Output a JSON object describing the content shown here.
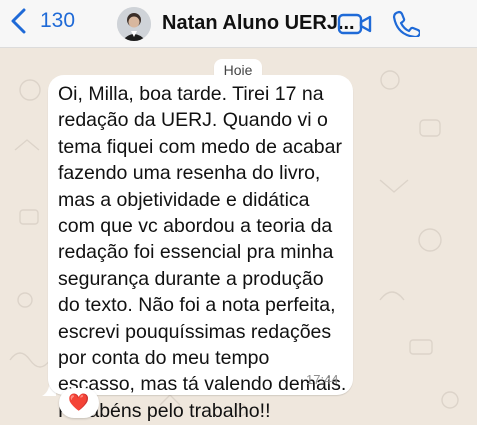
{
  "header": {
    "back_count": "130",
    "contact_name": "Natan Aluno UERJ..."
  },
  "chat": {
    "date_divider": "Hoje",
    "message": {
      "text": "Oi, Milla, boa tarde. Tirei 17 na redação da UERJ. Quando vi o tema fiquei com medo de acabar fazendo uma resenha do livro, mas a objetividade e didática com que vc abordou a teoria da redação foi essencial pra minha segurança durante a produção do texto. Não foi a nota perfeita, escrevi pouquíssimas redações por conta do meu tempo escasso, mas tá valendo demais. Parabéns pelo trabalho!!",
      "time": "17:44",
      "reaction": "❤️"
    }
  },
  "icons": {
    "back": "chevron-left-icon",
    "video": "video-call-icon",
    "phone": "phone-icon"
  },
  "colors": {
    "accent": "#1f6ad7",
    "background": "#efe7dd",
    "bubble": "#ffffff"
  }
}
